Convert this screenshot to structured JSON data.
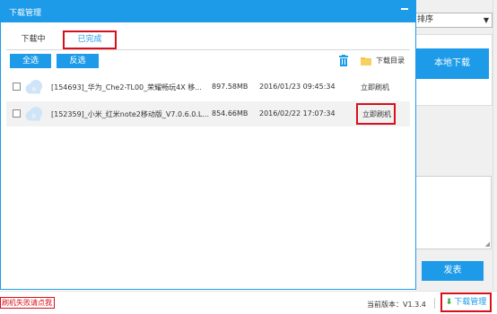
{
  "background": {
    "sort_label": "排序",
    "local_download_label": "本地下载",
    "post_button_label": "发表",
    "fail_link": "刷机失败请点我",
    "version_text": "当前版本：V1.3.4",
    "download_manager_label": "下载管理"
  },
  "dialog": {
    "title": "下载管理",
    "tabs": [
      {
        "label": "下载中",
        "active": false
      },
      {
        "label": "已完成",
        "active": true
      }
    ],
    "toolbar": {
      "select_all_label": "全选",
      "invert_label": "反选",
      "folder_label": "下载目录"
    },
    "rows": [
      {
        "name": "[154693]_华为_Che2-TL00_荣耀畅玩4X 移...",
        "size": "897.58MB",
        "date": "2016/01/23  09:45:34",
        "action": "立即刷机"
      },
      {
        "name": "[152359]_小米_红米note2移动版_V7.0.6.0.L...",
        "size": "854.66MB",
        "date": "2016/02/22 17:07:34",
        "action": "立即刷机"
      }
    ]
  },
  "colors": {
    "accent": "#1e9be8",
    "highlight": "#d8101a"
  }
}
